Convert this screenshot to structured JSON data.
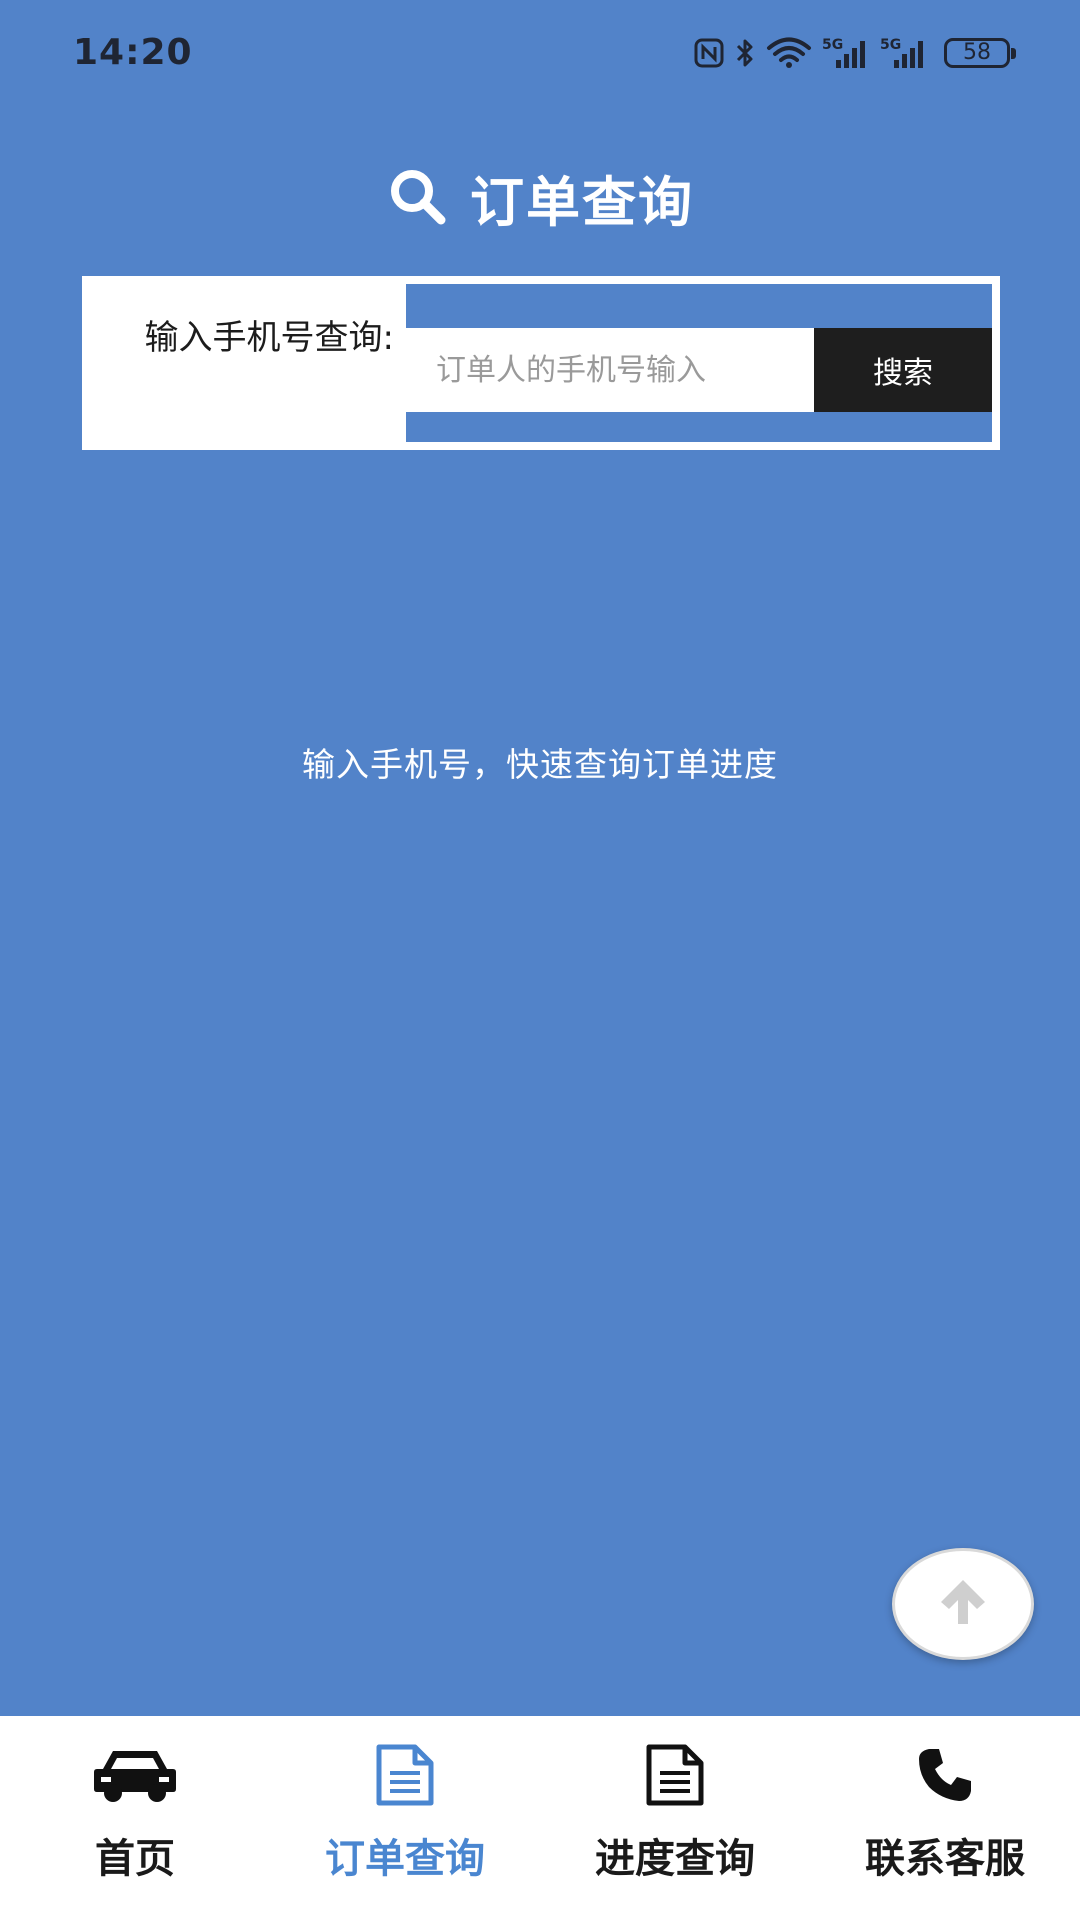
{
  "status_bar": {
    "time": "14:20",
    "battery_level": "58",
    "icons": [
      "nfc-icon",
      "bluetooth-icon",
      "wifi-icon",
      "signal-5g-icon",
      "signal-5g-icon",
      "battery-icon"
    ]
  },
  "header": {
    "title": "订单查询",
    "icon": "search-icon"
  },
  "search": {
    "label": "输入手机号查询:",
    "placeholder": "订单人的手机号输入",
    "value": "",
    "button_label": "搜索"
  },
  "hint": {
    "text": "输入手机号，快速查询订单进度"
  },
  "back_to_top": {
    "icon": "arrow-up-icon"
  },
  "tab_bar": {
    "items": [
      {
        "label": "首页",
        "icon": "car-icon",
        "active": false
      },
      {
        "label": "订单查询",
        "icon": "document-icon",
        "active": true
      },
      {
        "label": "进度查询",
        "icon": "document-icon",
        "active": false
      },
      {
        "label": "联系客服",
        "icon": "phone-icon",
        "active": false
      }
    ]
  },
  "colors": {
    "background": "#5283c9",
    "active_tab": "#4a86d0",
    "button": "#1e1e1e",
    "text_dark": "#1a1a1a",
    "white": "#ffffff"
  }
}
